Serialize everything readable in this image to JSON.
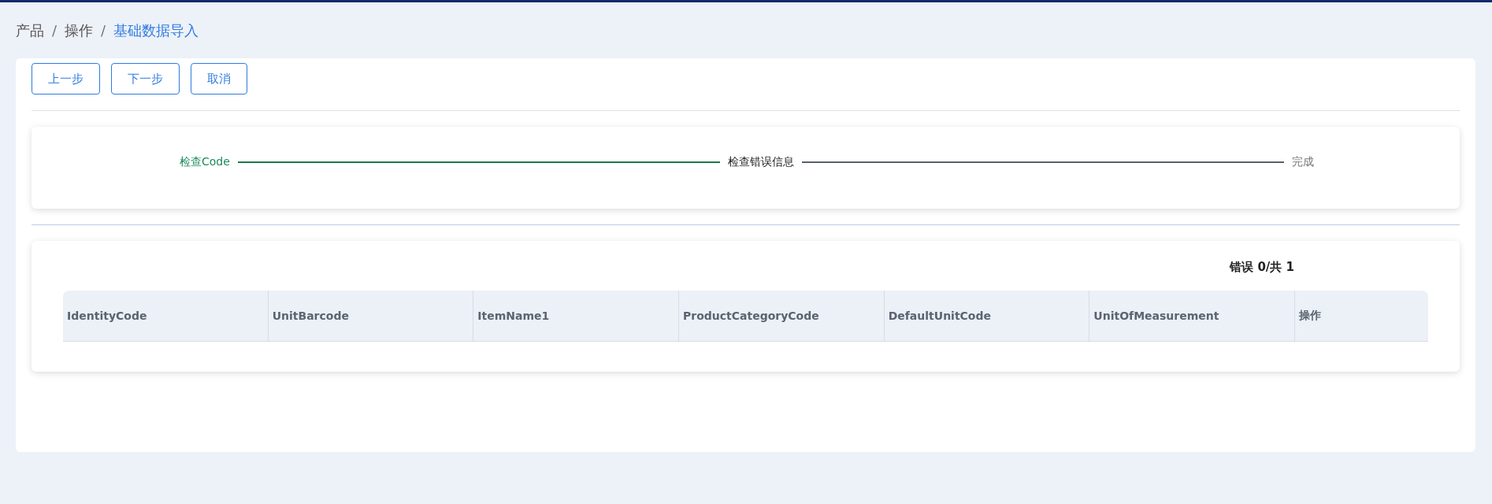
{
  "breadcrumb": [
    {
      "label": "产品",
      "selected": false
    },
    {
      "label": "操作",
      "selected": false
    },
    {
      "label": "基础数据导入",
      "selected": true
    }
  ],
  "separator": "/",
  "buttons": [
    "上一步",
    "下一步",
    "取消"
  ],
  "steps": [
    {
      "label": "检查Code",
      "done": true,
      "selected": false
    },
    {
      "label": "检查错误信息",
      "done": false,
      "selected": true
    },
    {
      "label": "完成",
      "done": false,
      "selected": false
    }
  ],
  "error_summary": "错误 0/共 1",
  "table": {
    "columns": [
      "IdentityCode",
      "UnitBarcode",
      "ItemName1",
      "ProductCategoryCode",
      "DefaultUnitCode",
      "UnitOfMeasurement",
      "操作"
    ]
  }
}
